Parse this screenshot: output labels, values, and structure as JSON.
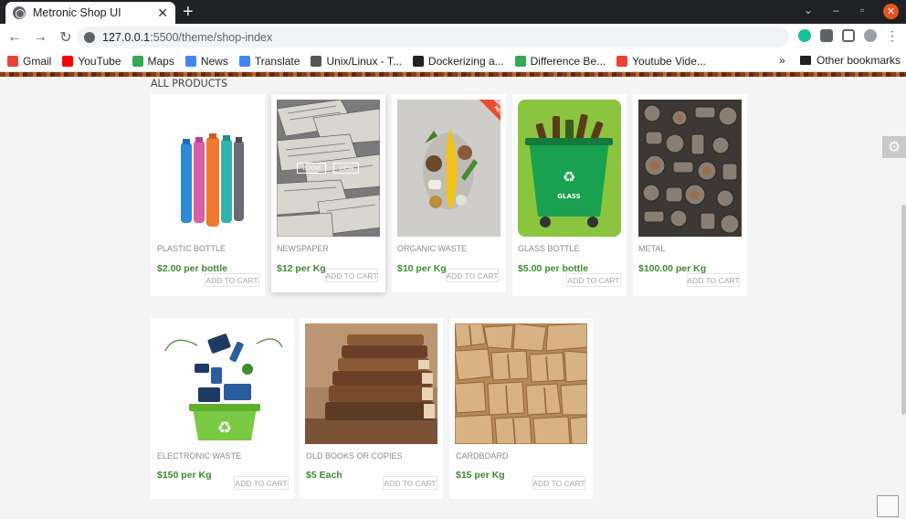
{
  "browser": {
    "tab_title": "Metronic Shop UI",
    "tab_close": "✕",
    "new_tab": "+",
    "url_host": "127.0.0.1",
    "url_path": ":5500/theme/shop-index",
    "bookmarks": [
      {
        "label": "Gmail",
        "color": "#ea4335"
      },
      {
        "label": "YouTube",
        "color": "#ff0000"
      },
      {
        "label": "Maps",
        "color": "#34a853"
      },
      {
        "label": "News",
        "color": "#4285f4"
      },
      {
        "label": "Translate",
        "color": "#4285f4"
      },
      {
        "label": "Unix/Linux - T...",
        "color": "#555555"
      },
      {
        "label": "Dockerizing a...",
        "color": "#222222"
      },
      {
        "label": "Difference Be...",
        "color": "#34a853"
      },
      {
        "label": "Youtube Vide...",
        "color": "#ea4335"
      }
    ],
    "bookmarks_more": "»",
    "other_bookmarks": "Other bookmarks"
  },
  "page": {
    "section_title": "ALL PRODUCTS",
    "products": [
      {
        "name": "PLASTIC BOTTLE",
        "price": "$2.00 per bottle",
        "cta": "ADD TO CART"
      },
      {
        "name": "NEWSPAPER",
        "price": "$12 per Kg",
        "cta": "ADD TO CART",
        "zoom": "ZOOM",
        "view": "VIEW"
      },
      {
        "name": "ORGANIC WASTE",
        "price": "$10 per Kg",
        "cta": "ADD TO CART",
        "badge": "NEW"
      },
      {
        "name": "GLASS BOTTLE",
        "price": "$5.00 per bottle",
        "cta": "ADD TO CART",
        "bin_label": "GLASS"
      },
      {
        "name": "METAL",
        "price": "$100.00 per Kg",
        "cta": "ADD TO CART"
      },
      {
        "name": "ELECTRONIC WASTE",
        "price": "$150 per Kg",
        "cta": "ADD TO CART"
      },
      {
        "name": "OLD BOOKS OR COPIES",
        "price": "$5 Each",
        "cta": "ADD TO CART"
      },
      {
        "name": "CARDBOARD",
        "price": "$15 per Kg",
        "cta": "ADD TO CART"
      }
    ]
  },
  "colors": {
    "price": "#3d8a2f",
    "badge": "#e84e2c",
    "glass_bg": "#8bc53f"
  }
}
